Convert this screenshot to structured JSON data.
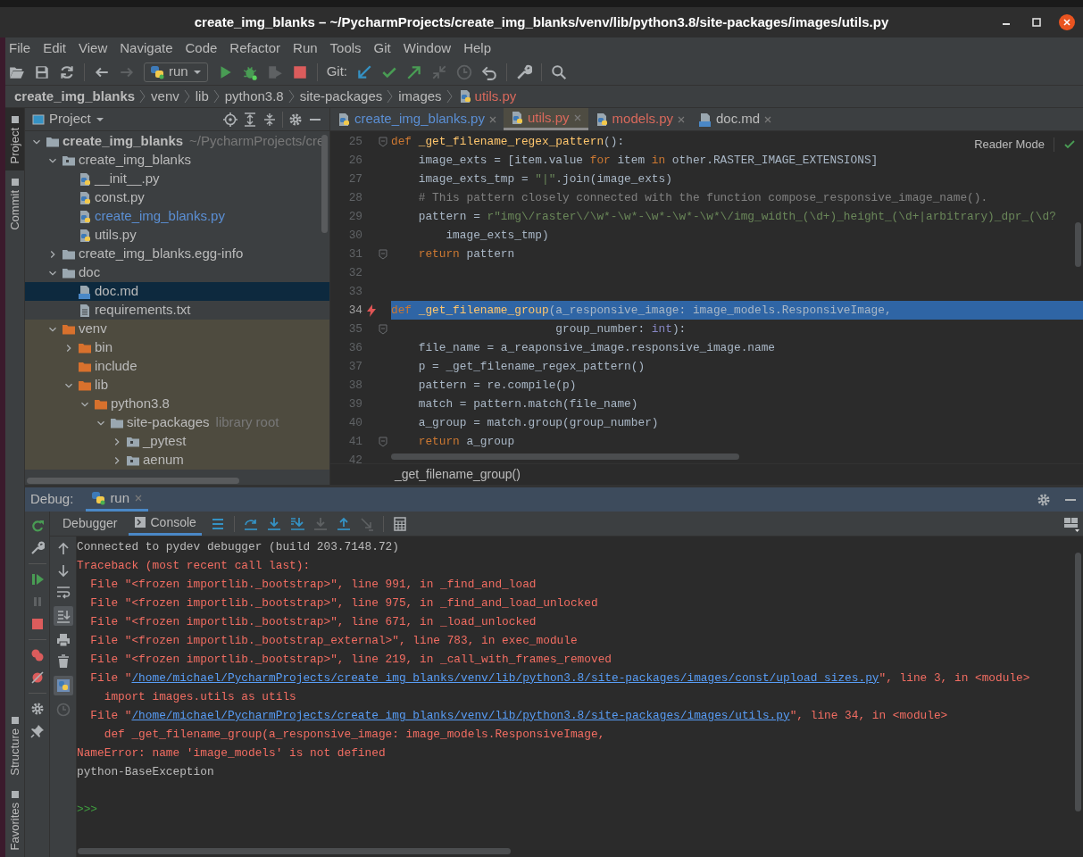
{
  "window": {
    "title": "create_img_blanks – ~/PycharmProjects/create_img_blanks/venv/lib/python3.8/site-packages/images/utils.py"
  },
  "menu": [
    "File",
    "Edit",
    "View",
    "Navigate",
    "Code",
    "Refactor",
    "Run",
    "Tools",
    "Git",
    "Window",
    "Help"
  ],
  "toolbar": {
    "run_config": "run",
    "git_label": "Git:"
  },
  "breadcrumbs": [
    {
      "label": "create_img_blanks",
      "kind": "root"
    },
    {
      "label": "venv",
      "kind": "folder"
    },
    {
      "label": "lib",
      "kind": "folder"
    },
    {
      "label": "python3.8",
      "kind": "folder"
    },
    {
      "label": "site-packages",
      "kind": "folder"
    },
    {
      "label": "images",
      "kind": "folder"
    },
    {
      "label": "utils.py",
      "kind": "python",
      "color": "#d9695c"
    }
  ],
  "tool_stripe": {
    "top": [
      {
        "label": "Project",
        "selected": true
      },
      {
        "label": "Commit",
        "selected": false
      }
    ],
    "bottom": [
      {
        "label": "Structure",
        "selected": false
      },
      {
        "label": "Favorites",
        "selected": false
      }
    ]
  },
  "project": {
    "title": "Project",
    "tree": [
      {
        "name": "create_img_blanks",
        "hint": "~/PycharmProjects/cre",
        "kind": "folder",
        "expanded": true,
        "selected": false,
        "children": [
          {
            "name": "create_img_blanks",
            "kind": "package",
            "expanded": true,
            "selected": false,
            "children": [
              {
                "name": "__init__.py",
                "kind": "python",
                "modified": false,
                "selected": false
              },
              {
                "name": "const.py",
                "kind": "python",
                "modified": false,
                "selected": false
              },
              {
                "name": "create_img_blanks.py",
                "kind": "python",
                "modified": true,
                "selected": false
              },
              {
                "name": "utils.py",
                "kind": "python",
                "modified": false,
                "selected": false
              }
            ]
          },
          {
            "name": "create_img_blanks.egg-info",
            "kind": "folder",
            "expanded": false,
            "selected": false
          },
          {
            "name": "doc",
            "kind": "folder",
            "expanded": true,
            "selected": false,
            "children": [
              {
                "name": "doc.md",
                "kind": "markdown",
                "selected": true
              },
              {
                "name": "requirements.txt",
                "kind": "text",
                "selected": false
              }
            ]
          },
          {
            "name": "venv",
            "kind": "excluded",
            "expanded": true,
            "selected": false,
            "children": [
              {
                "name": "bin",
                "kind": "excluded",
                "expanded": false,
                "selected": false
              },
              {
                "name": "include",
                "kind": "excluded",
                "selected": false
              },
              {
                "name": "lib",
                "kind": "excluded",
                "expanded": true,
                "selected": false,
                "children": [
                  {
                    "name": "python3.8",
                    "kind": "excluded",
                    "expanded": true,
                    "selected": false,
                    "children": [
                      {
                        "name": "site-packages",
                        "hint": "library root",
                        "kind": "folder",
                        "expanded": true,
                        "selected": false,
                        "children": [
                          {
                            "name": "_pytest",
                            "kind": "package",
                            "expanded": false,
                            "selected": false
                          },
                          {
                            "name": "aenum",
                            "kind": "package",
                            "expanded": false,
                            "selected": false
                          }
                        ]
                      }
                    ]
                  }
                ]
              }
            ]
          }
        ]
      }
    ]
  },
  "editor": {
    "tabs": [
      {
        "label": "create_img_blanks.py",
        "kind": "python",
        "color": "#5b8fd4",
        "selected": false
      },
      {
        "label": "utils.py",
        "kind": "python",
        "color": "#d9695c",
        "selected": true
      },
      {
        "label": "models.py",
        "kind": "python",
        "color": "#d9695c",
        "selected": false
      },
      {
        "label": "doc.md",
        "kind": "markdown",
        "color": "#bbbbbb",
        "selected": false
      }
    ],
    "reader_mode": "Reader Mode",
    "lines": [
      {
        "number": "25",
        "fold": true,
        "highlighted": false,
        "error": false,
        "tokens": [
          {
            "kind": "keyword",
            "text": "def "
          },
          {
            "kind": "function",
            "text": "_get_filename_regex_pattern"
          },
          {
            "kind": "plain",
            "text": "():"
          }
        ]
      },
      {
        "number": "26",
        "fold": false,
        "highlighted": false,
        "error": false,
        "tokens": [
          {
            "kind": "plain",
            "text": "    image_exts = [item.value "
          },
          {
            "kind": "keyword",
            "text": "for"
          },
          {
            "kind": "plain",
            "text": " item "
          },
          {
            "kind": "keyword",
            "text": "in"
          },
          {
            "kind": "plain",
            "text": " other.RASTER_IMAGE_EXTENSIONS]"
          }
        ]
      },
      {
        "number": "27",
        "fold": false,
        "highlighted": false,
        "error": false,
        "tokens": [
          {
            "kind": "plain",
            "text": "    image_exts_tmp = "
          },
          {
            "kind": "string",
            "text": "\"|\""
          },
          {
            "kind": "plain",
            "text": ".join(image_exts)"
          }
        ]
      },
      {
        "number": "28",
        "fold": false,
        "highlighted": false,
        "error": false,
        "tokens": [
          {
            "kind": "comment",
            "text": "    # This pattern closely connected with the function compose_responsive_image_name()."
          }
        ]
      },
      {
        "number": "29",
        "fold": false,
        "highlighted": false,
        "error": false,
        "tokens": [
          {
            "kind": "plain",
            "text": "    pattern = "
          },
          {
            "kind": "string",
            "text": "r\"img\\/raster\\/\\w*-\\w*-\\w*-\\w*-\\w*\\/img_width_(\\d+)_height_(\\d+|arbitrary)_dpr_(\\d?"
          }
        ]
      },
      {
        "number": "30",
        "fold": false,
        "highlighted": false,
        "error": false,
        "tokens": [
          {
            "kind": "plain",
            "text": "        image_exts_tmp)"
          }
        ]
      },
      {
        "number": "31",
        "fold": true,
        "highlighted": false,
        "error": false,
        "tokens": [
          {
            "kind": "keyword",
            "text": "    return"
          },
          {
            "kind": "plain",
            "text": " pattern"
          }
        ]
      },
      {
        "number": "32",
        "fold": false,
        "highlighted": false,
        "error": false
      },
      {
        "number": "33",
        "fold": false,
        "highlighted": false,
        "error": false
      },
      {
        "number": "34",
        "fold": false,
        "highlighted": true,
        "error": true,
        "tokens": [
          {
            "kind": "keyword",
            "text": "def "
          },
          {
            "kind": "function",
            "text": "_get_filename_group"
          },
          {
            "kind": "plain",
            "text": "(a_responsive_image: image_models.ResponsiveImage,"
          }
        ]
      },
      {
        "number": "35",
        "fold": true,
        "highlighted": false,
        "error": false,
        "tokens": [
          {
            "kind": "plain",
            "text": "                        group_number: "
          },
          {
            "kind": "builtin",
            "text": "int"
          },
          {
            "kind": "plain",
            "text": "):"
          }
        ]
      },
      {
        "number": "36",
        "fold": false,
        "highlighted": false,
        "error": false,
        "tokens": [
          {
            "kind": "plain",
            "text": "    file_name = a_reaponsive_image.responsive_image.name"
          }
        ]
      },
      {
        "number": "37",
        "fold": false,
        "highlighted": false,
        "error": false,
        "tokens": [
          {
            "kind": "plain",
            "text": "    p = _get_filename_regex_pattern()"
          }
        ]
      },
      {
        "number": "38",
        "fold": false,
        "highlighted": false,
        "error": false,
        "tokens": [
          {
            "kind": "plain",
            "text": "    pattern = re.compile(p)"
          }
        ]
      },
      {
        "number": "39",
        "fold": false,
        "highlighted": false,
        "error": false,
        "tokens": [
          {
            "kind": "plain",
            "text": "    match = pattern.match(file_name)"
          }
        ]
      },
      {
        "number": "40",
        "fold": false,
        "highlighted": false,
        "error": false,
        "tokens": [
          {
            "kind": "plain",
            "text": "    a_group = match.group(group_number)"
          }
        ]
      },
      {
        "number": "41",
        "fold": true,
        "highlighted": false,
        "error": false,
        "tokens": [
          {
            "kind": "keyword",
            "text": "    return"
          },
          {
            "kind": "plain",
            "text": " a_group"
          }
        ]
      },
      {
        "number": "42",
        "fold": false,
        "highlighted": false,
        "error": false
      }
    ],
    "breadcrumb": "_get_filename_group()"
  },
  "debug": {
    "title": "Debug:",
    "session_tabs": [
      {
        "label": "run",
        "selected": true
      }
    ],
    "tabs": [
      {
        "label": "Debugger",
        "selected": false
      },
      {
        "label": "Console",
        "selected": true
      }
    ],
    "console": [
      {
        "kind": "info",
        "text": "Connected to pydev debugger (build 203.7148.72)"
      },
      {
        "kind": "error",
        "text": "Traceback (most recent call last):"
      },
      {
        "kind": "error",
        "text": "  File \"<frozen importlib._bootstrap>\", line 991, in _find_and_load"
      },
      {
        "kind": "error",
        "text": "  File \"<frozen importlib._bootstrap>\", line 975, in _find_and_load_unlocked"
      },
      {
        "kind": "error",
        "text": "  File \"<frozen importlib._bootstrap>\", line 671, in _load_unlocked"
      },
      {
        "kind": "error",
        "text": "  File \"<frozen importlib._bootstrap_external>\", line 783, in exec_module"
      },
      {
        "kind": "error",
        "text": "  File \"<frozen importlib._bootstrap>\", line 219, in _call_with_frames_removed"
      },
      {
        "kind": "link",
        "prefix": "  File \"",
        "link": "/home/michael/PycharmProjects/create_img_blanks/venv/lib/python3.8/site-packages/images/const/upload_sizes.py",
        "suffix": "\", line 3, in <module>"
      },
      {
        "kind": "error",
        "text": "    import images.utils as utils"
      },
      {
        "kind": "link",
        "prefix": "  File \"",
        "link": "/home/michael/PycharmProjects/create_img_blanks/venv/lib/python3.8/site-packages/images/utils.py",
        "suffix": "\", line 34, in <module>"
      },
      {
        "kind": "error",
        "text": "    def _get_filename_group(a_responsive_image: image_models.ResponsiveImage,"
      },
      {
        "kind": "error",
        "text": "NameError: name 'image_models' is not defined"
      },
      {
        "kind": "info",
        "text": "python-BaseException"
      },
      {
        "kind": "blank"
      },
      {
        "kind": "prompt",
        "text": ">>>"
      }
    ]
  }
}
